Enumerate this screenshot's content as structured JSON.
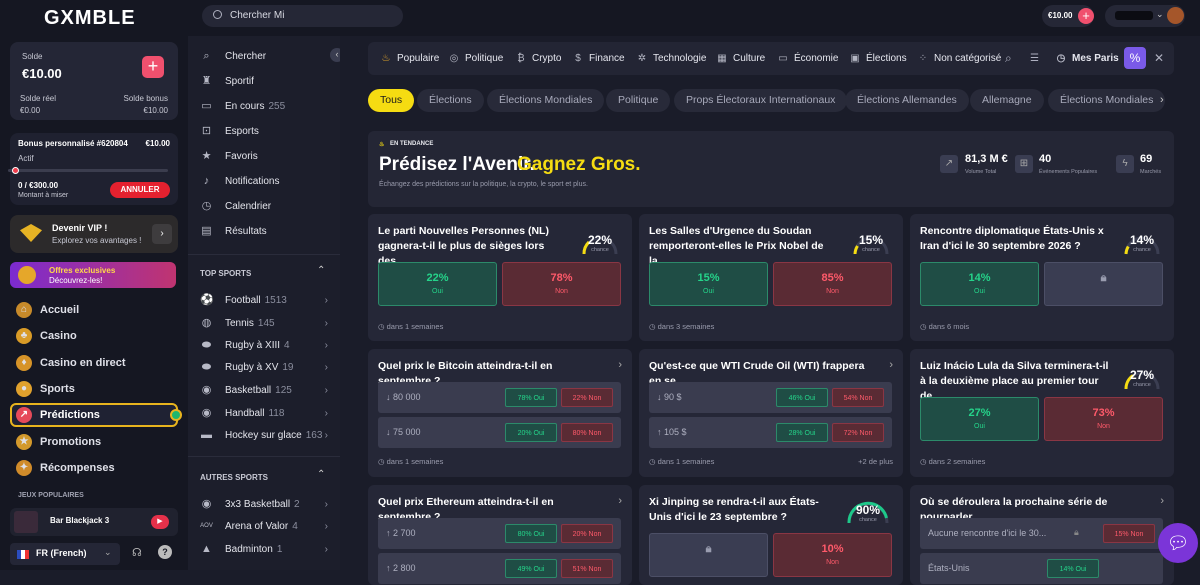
{
  "logo": "GXMBLE",
  "search": {
    "placeholder": "Chercher",
    "value": "Chercher Mi"
  },
  "header": {
    "balance": "€10.00"
  },
  "wallet": {
    "title": "Solde",
    "amount": "€10.00",
    "real_label": "Solde réel",
    "real_value": "€0.00",
    "bonus_label": "Solde bonus",
    "bonus_value": "€10.00"
  },
  "bonus": {
    "title": "Bonus personnalisé #620804",
    "amount": "€10.00",
    "status": "Actif",
    "progress": "0 / €300.00",
    "progress_label": "Montant à miser",
    "cancel": "ANNULER"
  },
  "vip": {
    "title": "Devenir VIP !",
    "subtitle": "Explorez vos avantages !"
  },
  "offers": {
    "title": "Offres exclusives",
    "subtitle": "Découvrez-les!"
  },
  "nav": [
    {
      "label": "Accueil",
      "icon": "home-icon"
    },
    {
      "label": "Casino",
      "icon": "casino-icon"
    },
    {
      "label": "Casino en direct",
      "icon": "live-casino-icon"
    },
    {
      "label": "Sports",
      "icon": "sports-icon"
    },
    {
      "label": "Prédictions",
      "icon": "predictions-icon"
    },
    {
      "label": "Promotions",
      "icon": "promotions-icon"
    },
    {
      "label": "Récompenses",
      "icon": "rewards-icon"
    }
  ],
  "popular_games": {
    "title": "JEUX POPULAIRES",
    "game": "Bar Blackjack 3"
  },
  "language": "FR (French)",
  "sidebar2": {
    "items": [
      "Chercher",
      "Sportif",
      "En cours",
      "Esports",
      "Favoris",
      "Notifications",
      "Calendrier",
      "Résultats"
    ],
    "live_count": "255",
    "top_sports_title": "TOP SPORTS",
    "top_sports": [
      {
        "name": "Football",
        "count": "1513"
      },
      {
        "name": "Tennis",
        "count": "145"
      },
      {
        "name": "Rugby à XIII",
        "count": "4"
      },
      {
        "name": "Rugby à XV",
        "count": "19"
      },
      {
        "name": "Basketball",
        "count": "125"
      },
      {
        "name": "Handball",
        "count": "118"
      },
      {
        "name": "Hockey sur glace",
        "count": "163"
      }
    ],
    "other_sports_title": "AUTRES SPORTS",
    "other_sports": [
      {
        "name": "3x3 Basketball",
        "count": "2"
      },
      {
        "name": "Arena of Valor",
        "count": "4"
      },
      {
        "name": "Badminton",
        "count": "1"
      }
    ]
  },
  "categories": [
    "Populaire",
    "Politique",
    "Crypto",
    "Finance",
    "Technologie",
    "Culture",
    "Économie",
    "Élections",
    "Non catégorisé",
    "Mes Paris"
  ],
  "chips": [
    "Tous",
    "Élections",
    "Élections Mondiales",
    "Politique",
    "Props Électoraux Internationaux",
    "Élections Allemandes",
    "Allemagne",
    "Élections Mondiales"
  ],
  "hero": {
    "badge": "EN TENDANCE",
    "title_a": "Prédisez l'Avenir.",
    "title_b": "Gagnez Gros.",
    "subtitle": "Échangez des prédictions sur la politique, la crypto, le sport et plus.",
    "stats": [
      {
        "value": "81,3 M €",
        "label": "Volume Total"
      },
      {
        "value": "40",
        "label": "Événements Populaires"
      },
      {
        "value": "69",
        "label": "Marchés"
      }
    ]
  },
  "cards": {
    "c1": {
      "q": "Le parti Nouvelles Personnes (NL) gagnera-t-il le plus de sièges lors des...",
      "pct": "22%",
      "chance": "chance",
      "yes": "22%",
      "no": "78%",
      "yes_l": "Oui",
      "no_l": "Non",
      "foot": "dans 1 semaines"
    },
    "c2": {
      "q": "Les Salles d'Urgence du Soudan remporteront-elles le Prix Nobel de la...",
      "pct": "15%",
      "chance": "chance",
      "yes": "15%",
      "no": "85%",
      "yes_l": "Oui",
      "no_l": "Non",
      "foot": "dans 3 semaines"
    },
    "c3": {
      "q": "Rencontre diplomatique États-Unis x Iran d'ici le 30 septembre 2026 ?",
      "pct": "14%",
      "chance": "chance",
      "yes": "14%",
      "yes_l": "Oui",
      "foot": "dans 6 mois"
    },
    "c4": {
      "q": "Quel prix le Bitcoin atteindra-t-il en septembre ?",
      "rows": [
        {
          "l": "↓ 80 000",
          "y": "78% Oui",
          "n": "22% Non"
        },
        {
          "l": "↓ 75 000",
          "y": "20% Oui",
          "n": "80% Non"
        }
      ],
      "foot": "dans 1 semaines"
    },
    "c5": {
      "q": "Qu'est-ce que WTI Crude Oil (WTI) frappera en se...",
      "rows": [
        {
          "l": "↓ 90 $",
          "y": "46% Oui",
          "n": "54% Non"
        },
        {
          "l": "↑ 105 $",
          "y": "28% Oui",
          "n": "72% Non"
        }
      ],
      "foot": "dans 1 semaines",
      "more": "+2 de plus"
    },
    "c6": {
      "q": "Luiz Inácio Lula da Silva terminera-t-il à la deuxième place au premier tour de...",
      "pct": "27%",
      "chance": "chance",
      "yes": "27%",
      "no": "73%",
      "yes_l": "Oui",
      "no_l": "Non",
      "foot": "dans 2 semaines"
    },
    "c7": {
      "q": "Quel prix Ethereum atteindra-t-il en septembre ?",
      "rows": [
        {
          "l": "↑ 2 700",
          "y": "80% Oui",
          "n": "20% Non"
        },
        {
          "l": "↑ 2 800",
          "y": "49% Oui",
          "n": "51% Non"
        }
      ]
    },
    "c8": {
      "q": "Xi Jinping se rendra-t-il aux États-Unis d'ici le 23 septembre ?",
      "pct": "90%",
      "chance": "chance",
      "no": "10%",
      "no_l": "Non"
    },
    "c9": {
      "q": "Où se déroulera la prochaine série de pourparler...",
      "rows": [
        {
          "l": "Aucune rencontre d'ici le 30...",
          "n": "15% Non"
        },
        {
          "l": "États-Unis",
          "y": "14% Oui"
        }
      ]
    }
  }
}
